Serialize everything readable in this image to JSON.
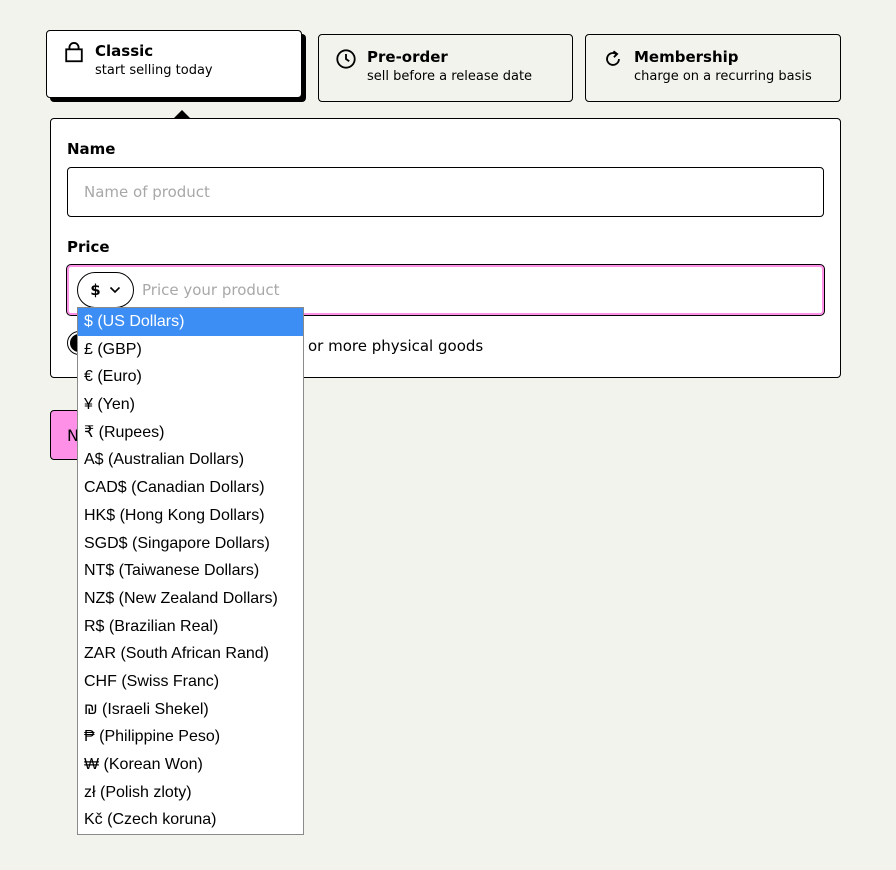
{
  "product_types": [
    {
      "title": "Classic",
      "subtitle": "start selling today",
      "icon": "shopping-bag-icon",
      "selected": true
    },
    {
      "title": "Pre-order",
      "subtitle": "sell before a release date",
      "icon": "clock-icon",
      "selected": false
    },
    {
      "title": "Membership",
      "subtitle": "charge on a recurring basis",
      "icon": "refresh-icon",
      "selected": false
    }
  ],
  "form": {
    "name_label": "Name",
    "name_placeholder": "Name of product",
    "price_label": "Price",
    "currency_symbol": "$",
    "price_placeholder": "Price your product",
    "physical_toggle_label": "This is one or more physical goods",
    "physical_toggle_visible_text": "e or more physical goods"
  },
  "next_button_visible_text": "N",
  "currency_dropdown": {
    "selected_index": 0,
    "options": [
      "$ (US Dollars)",
      "£ (GBP)",
      "€ (Euro)",
      "¥ (Yen)",
      "₹ (Rupees)",
      "A$ (Australian Dollars)",
      "CAD$ (Canadian Dollars)",
      "HK$ (Hong Kong Dollars)",
      "SGD$ (Singapore Dollars)",
      "NT$ (Taiwanese Dollars)",
      "NZ$ (New Zealand Dollars)",
      "R$ (Brazilian Real)",
      "ZAR (South African Rand)",
      "CHF (Swiss Franc)",
      "₪ (Israeli Shekel)",
      "₱ (Philippine Peso)",
      "₩ (Korean Won)",
      "zł (Polish zloty)",
      "Kč (Czech koruna)"
    ]
  },
  "colors": {
    "background": "#f3f3ee",
    "accent_pink": "#ff90e8",
    "selection_blue": "#3c8ef5"
  }
}
